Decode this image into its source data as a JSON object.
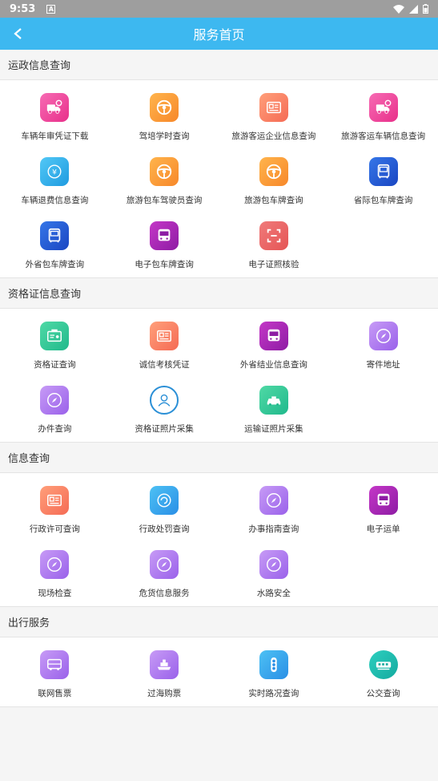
{
  "status": {
    "time": "9:53"
  },
  "header": {
    "title": "服务首页"
  },
  "sections": [
    {
      "title": "运政信息查询",
      "items": [
        {
          "label": "车辆年审凭证下载",
          "icon": "truck-icon",
          "color": "pink"
        },
        {
          "label": "驾培学时查询",
          "icon": "steering-wheel-icon",
          "color": "orange"
        },
        {
          "label": "旅游客运企业信息查询",
          "icon": "id-card-icon",
          "color": "salmon"
        },
        {
          "label": "旅游客运车辆信息查询",
          "icon": "truck-icon",
          "color": "pink"
        },
        {
          "label": "车辆退费信息查询",
          "icon": "refund-icon",
          "color": "sky"
        },
        {
          "label": "旅游包车驾驶员查询",
          "icon": "steering-wheel-icon",
          "color": "orange"
        },
        {
          "label": "旅游包车牌查询",
          "icon": "steering-wheel-icon",
          "color": "orange"
        },
        {
          "label": "省际包车牌查询",
          "icon": "bus-icon",
          "color": "navy"
        },
        {
          "label": "外省包车牌查询",
          "icon": "bus-icon",
          "color": "navy"
        },
        {
          "label": "电子包车牌查询",
          "icon": "bus-front-icon",
          "color": "magenta"
        },
        {
          "label": "电子证照核验",
          "icon": "scan-icon",
          "color": "red"
        }
      ]
    },
    {
      "title": "资格证信息查询",
      "items": [
        {
          "label": "资格证查询",
          "icon": "certificate-icon",
          "color": "green"
        },
        {
          "label": "诚信考核凭证",
          "icon": "id-card-icon",
          "color": "salmon"
        },
        {
          "label": "外省结业信息查询",
          "icon": "bus-front-icon",
          "color": "magenta"
        },
        {
          "label": "寄件地址",
          "icon": "compass-icon",
          "color": "violet"
        },
        {
          "label": "办件查询",
          "icon": "compass-icon",
          "color": "violet"
        },
        {
          "label": "资格证照片采集",
          "icon": "person-icon",
          "color": "ring"
        },
        {
          "label": "运输证照片采集",
          "icon": "taxi-icon",
          "color": "green"
        }
      ]
    },
    {
      "title": "信息查询",
      "items": [
        {
          "label": "行政许可查询",
          "icon": "id-card-icon",
          "color": "salmon"
        },
        {
          "label": "行政处罚查询",
          "icon": "penalty-icon",
          "color": "blue"
        },
        {
          "label": "办事指南查询",
          "icon": "compass-icon",
          "color": "violet"
        },
        {
          "label": "电子运单",
          "icon": "bus-front-icon",
          "color": "magenta"
        },
        {
          "label": "现场检查",
          "icon": "compass-icon",
          "color": "violet"
        },
        {
          "label": "危货信息服务",
          "icon": "compass-icon",
          "color": "violet"
        },
        {
          "label": "水路安全",
          "icon": "compass-icon",
          "color": "violet"
        }
      ]
    },
    {
      "title": "出行服务",
      "items": [
        {
          "label": "联网售票",
          "icon": "coach-icon",
          "color": "violet"
        },
        {
          "label": "过海购票",
          "icon": "ship-icon",
          "color": "violet"
        },
        {
          "label": "实时路况查询",
          "icon": "traffic-light-icon",
          "color": "blue"
        },
        {
          "label": "公交查询",
          "icon": "tram-icon",
          "color": "teal"
        }
      ]
    }
  ]
}
